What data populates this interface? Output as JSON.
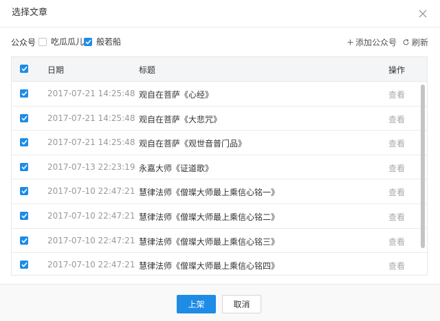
{
  "dialog": {
    "title": "选择文章"
  },
  "toolbar": {
    "label": "公众号",
    "accounts": [
      {
        "name": "吃瓜瓜儿",
        "checked": false
      },
      {
        "name": "般若船",
        "checked": true
      }
    ],
    "add_label": "添加公众号",
    "refresh_label": "刷新"
  },
  "table": {
    "columns": {
      "date": "日期",
      "title": "标题",
      "action": "操作"
    },
    "header_checked": true,
    "rows": [
      {
        "checked": true,
        "date": "2017-07-21 14:25:48",
        "title": "观自在菩萨《心经》",
        "action": "查看"
      },
      {
        "checked": true,
        "date": "2017-07-21 14:25:48",
        "title": "观自在菩萨《大悲咒》",
        "action": "查看"
      },
      {
        "checked": true,
        "date": "2017-07-21 14:25:48",
        "title": "观自在菩萨《观世音普门品》",
        "action": "查看"
      },
      {
        "checked": true,
        "date": "2017-07-13 22:23:19",
        "title": "永嘉大师《证道歌》",
        "action": "查看"
      },
      {
        "checked": true,
        "date": "2017-07-10 22:47:21",
        "title": "慧律法师《僧璨大师最上乘信心铭一》",
        "action": "查看"
      },
      {
        "checked": true,
        "date": "2017-07-10 22:47:21",
        "title": "慧律法师《僧璨大师最上乘信心铭二》",
        "action": "查看"
      },
      {
        "checked": true,
        "date": "2017-07-10 22:47:21",
        "title": "慧律法师《僧璨大师最上乘信心铭三》",
        "action": "查看"
      },
      {
        "checked": true,
        "date": "2017-07-10 22:47:21",
        "title": "慧律法师《僧璨大师最上乘信心铭四》",
        "action": "查看"
      }
    ]
  },
  "footer": {
    "confirm_label": "上架",
    "cancel_label": "取消"
  },
  "colors": {
    "accent": "#1e8ce6",
    "muted_text": "#999999",
    "border": "#e8e8e8"
  }
}
